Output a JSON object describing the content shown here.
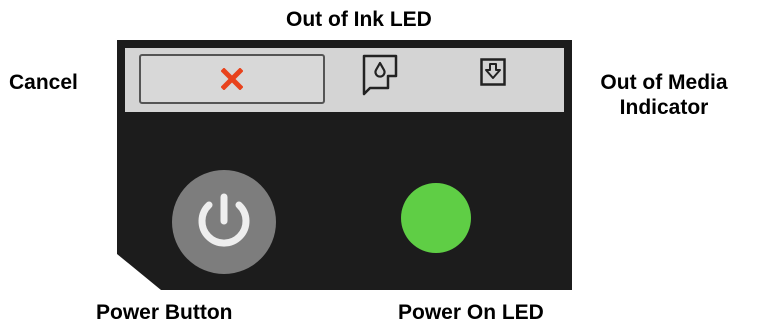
{
  "labels": {
    "out_of_ink_led": "Out of Ink LED",
    "cancel": "Cancel",
    "out_of_media_indicator": "Out of Media Indicator",
    "power_button": "Power Button",
    "power_on_led": "Power On LED"
  },
  "panel": {
    "background_color": "#1c1c1c",
    "strip_color": "#d4d4d4",
    "cancel_icon": "x-icon",
    "cancel_icon_color": "#e8421c",
    "ink_icon": "ink-drop-icon",
    "media_icon": "down-arrow-icon",
    "power_icon": "power-icon",
    "power_button_color": "#7d7d7d",
    "power_led_color": "#5fce45"
  }
}
